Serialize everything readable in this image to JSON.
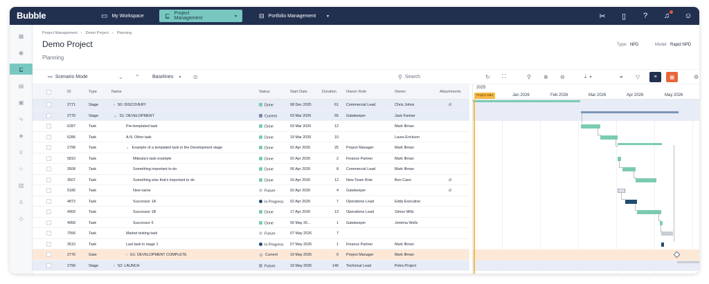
{
  "app": {
    "logo": "Bubble"
  },
  "nav": {
    "tabs": [
      {
        "label": "My Workspace",
        "icon": "monitor-icon"
      },
      {
        "label": "Project Management",
        "icon": "gantt-icon",
        "active": true
      },
      {
        "label": "Portfolio Management",
        "icon": "briefcase-icon"
      }
    ]
  },
  "breadcrumb": [
    "Project Management",
    "Demo Project",
    "Planning"
  ],
  "page": {
    "title": "Demo Project",
    "subtitle": "Planning"
  },
  "meta": {
    "type_label": "Type:",
    "type_value": "NPD",
    "model_label": "Model:",
    "model_value": "Rapid NPD"
  },
  "toolbar": {
    "scenario_mode": "Scenario Mode",
    "baselines": "Baselines",
    "search_placeholder": "Search"
  },
  "columns": {
    "id": "ID",
    "type": "Type",
    "name": "Name",
    "status": "Status",
    "start": "Start Date",
    "duration": "Duration",
    "owner_role": "Owner Role",
    "owner": "Owner",
    "attachments": "Attachments"
  },
  "rows": [
    {
      "id": "2771",
      "type": "Stage",
      "name": "S0: DISCOVERY",
      "chevron": "›",
      "status": "Done",
      "status_kind": "done",
      "start": "08 Dec 2025",
      "duration": "61",
      "owner_role": "Commercial Lead",
      "owner": "Chris Johns",
      "attach": true,
      "row_kind": "stage",
      "level": 0
    },
    {
      "id": "2775",
      "type": "Stage",
      "name": "S1: DEVELOPMENT",
      "chevron": "⌄",
      "status": "Current",
      "status_kind": "current",
      "start": "03 Mar 2026",
      "duration": "55",
      "owner_role": "Gatekeeper",
      "owner": "Jack Farmer",
      "attach": false,
      "row_kind": "stage",
      "level": 0
    },
    {
      "id": "6287",
      "type": "Task",
      "name": "Pre-templated task",
      "chevron": "",
      "status": "Done",
      "status_kind": "done",
      "start": "03 Mar 2026",
      "duration": "12",
      "owner_role": "",
      "owner": "Mark Illman",
      "attach": false,
      "row_kind": "task",
      "level": 1
    },
    {
      "id": "6286",
      "type": "Task",
      "name": "A.N. Other task",
      "chevron": "",
      "status": "Done",
      "status_kind": "done",
      "start": "19 Mar 2026",
      "duration": "10",
      "owner_role": "",
      "owner": "Laura Erickson",
      "attach": false,
      "row_kind": "task",
      "level": 1
    },
    {
      "id": "2798",
      "type": "Task",
      "name": "Example of a templated task in the Development stage",
      "chevron": "⌄",
      "status": "Done",
      "status_kind": "done",
      "start": "02 Apr 2026",
      "duration": "25",
      "owner_role": "Project Manager",
      "owner": "Mark Illman",
      "attach": false,
      "row_kind": "task",
      "level": 1
    },
    {
      "id": "5810",
      "type": "Task",
      "name": "Mikeala's task example",
      "chevron": "",
      "status": "Done",
      "status_kind": "done",
      "start": "02 Apr 2026",
      "duration": "2",
      "owner_role": "Finance Partner",
      "owner": "Mark Illman",
      "attach": false,
      "row_kind": "task",
      "level": 2
    },
    {
      "id": "3508",
      "type": "Task",
      "name": "Something important to do",
      "chevron": "",
      "status": "Done",
      "status_kind": "done",
      "start": "06 Apr 2026",
      "duration": "8",
      "owner_role": "Commercial Lead",
      "owner": "Mark Illman",
      "attach": false,
      "row_kind": "task",
      "level": 2
    },
    {
      "id": "3507",
      "type": "Task",
      "name": "Something else that's important to do",
      "chevron": "",
      "status": "Done",
      "status_kind": "done",
      "start": "16 Apr 2026",
      "duration": "12",
      "owner_role": "New Team Role",
      "owner": "Ben Cann",
      "attach": true,
      "row_kind": "task",
      "level": 2
    },
    {
      "id": "5186",
      "type": "Task",
      "name": "New name",
      "chevron": "",
      "status": "Future",
      "status_kind": "future",
      "start": "02 Apr 2026",
      "duration": "4",
      "owner_role": "Gatekeeper",
      "owner": "",
      "attach": true,
      "row_kind": "task",
      "level": 2
    },
    {
      "id": "4872",
      "type": "Task",
      "name": "Successor 1A",
      "chevron": "",
      "status": "In Progress",
      "status_kind": "progress",
      "start": "02 Apr 2026",
      "duration": "7",
      "owner_role": "Operations Lead",
      "owner": "Eddy Executive",
      "attach": false,
      "row_kind": "task",
      "level": 2
    },
    {
      "id": "4900",
      "type": "Task",
      "name": "Successor 1B",
      "chevron": "",
      "status": "Done",
      "status_kind": "done",
      "start": "17 Apr 2026",
      "duration": "13",
      "owner_role": "Operations Lead",
      "owner": "Simon Mills",
      "attach": false,
      "row_kind": "task",
      "level": 2
    },
    {
      "id": "4958",
      "type": "Task",
      "name": "Successor 5",
      "chevron": "",
      "status": "Done",
      "status_kind": "done",
      "start": "06 May 20...",
      "duration": "1",
      "owner_role": "Gatekeeper",
      "owner": "Jemima Wells",
      "attach": false,
      "row_kind": "task",
      "level": 2
    },
    {
      "id": "7556",
      "type": "Task",
      "name": "Market testing task",
      "chevron": "",
      "status": "Future",
      "status_kind": "future",
      "start": "07 May 2026",
      "duration": "7",
      "owner_role": "",
      "owner": "",
      "attach": false,
      "row_kind": "task",
      "level": 1
    },
    {
      "id": "3510",
      "type": "Task",
      "name": "Last task in stage 1",
      "chevron": "",
      "status": "In Progress",
      "status_kind": "progress",
      "start": "07 May 2026",
      "duration": "1",
      "owner_role": "Finance Partner",
      "owner": "Mark Illman",
      "attach": false,
      "row_kind": "task",
      "level": 1
    },
    {
      "id": "2776",
      "type": "Gate",
      "name": "G1: DEVELOPMENT COMPLETE",
      "chevron": "›",
      "status": "Current",
      "status_kind": "gate-current",
      "start": "19 May 2026",
      "duration": "0",
      "owner_role": "Project Manager",
      "owner": "Mark Illman",
      "attach": false,
      "row_kind": "gate",
      "level": 1
    },
    {
      "id": "2799",
      "type": "Stage",
      "name": "S2: LAUNCH",
      "chevron": "›",
      "status": "Future",
      "status_kind": "future-sq",
      "start": "19 May 2026",
      "duration": "140",
      "owner_role": "Technical Lead",
      "owner": "Petra Project",
      "attach": false,
      "row_kind": "stage",
      "level": 0
    }
  ],
  "gantt": {
    "year": "2025",
    "months": [
      "Jan 2026",
      "Feb 2026",
      "Mar 2026",
      "Apr 2026",
      "May 2026"
    ],
    "project_start_label": "Project start"
  },
  "colors": {
    "nav_bg": "#22304f",
    "accent": "#78c8c1",
    "done": "#7ccbb1",
    "progress": "#234b6e",
    "future": "#c8ccd3",
    "stage_bar": "#7b95b5",
    "orange": "#e8673a"
  }
}
